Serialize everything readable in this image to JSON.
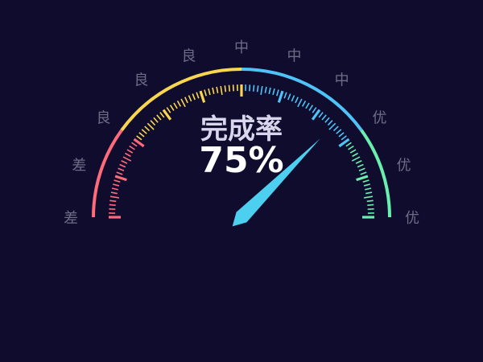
{
  "chart_data": {
    "type": "gauge",
    "title": "完成率",
    "value": 75,
    "value_text": "75%",
    "min": 0,
    "max": 100,
    "tick_labels": [
      "差",
      "差",
      "良",
      "良",
      "良",
      "中",
      "中",
      "中",
      "优",
      "优",
      "优"
    ],
    "bands": [
      {
        "from": 0,
        "to": 20,
        "color": "#ff6b7a"
      },
      {
        "from": 20,
        "to": 50,
        "color": "#f9d64f"
      },
      {
        "from": 50,
        "to": 80,
        "color": "#4fc3f7"
      },
      {
        "from": 80,
        "to": 100,
        "color": "#69f0ae"
      }
    ],
    "colors": {
      "background": "#0f0c2e",
      "pointer": "#4dd0f0",
      "title": "#d9d5ec",
      "value": "#ffffff",
      "tick_label": "#6f6a85"
    }
  }
}
